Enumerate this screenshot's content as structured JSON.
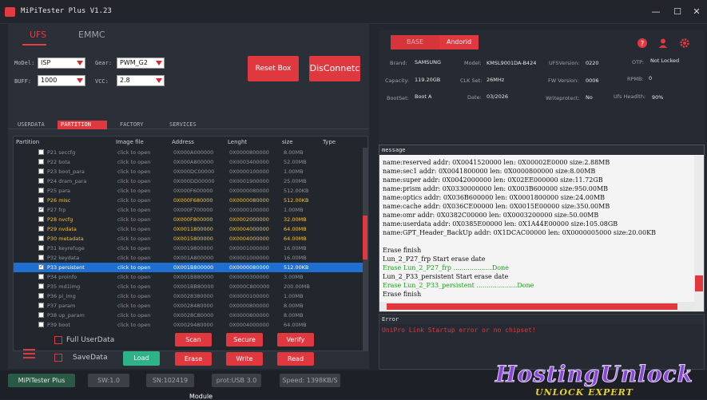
{
  "window": {
    "title": "MiPiTester Plus V1.23"
  },
  "tabs": {
    "ufs": "UFS",
    "emmc": "EMMC"
  },
  "config": {
    "model_label": "MoDel:",
    "model_value": "ISP",
    "gear_label": "Gear:",
    "gear_value": "PWM_G2",
    "buff_label": "BUFF:",
    "buff_value": "1000",
    "vcc_label": "VCC:",
    "vcc_value": "2.8"
  },
  "buttons": {
    "reset_box": "Reset Box",
    "disconnect": "DisConnetc"
  },
  "subtabs": [
    "USERDATA",
    "PARTITION",
    "FACTORY",
    "SERVICES"
  ],
  "table": {
    "headers": [
      "Partition",
      "Image file",
      "Address",
      "Lenght",
      "size",
      "Type"
    ],
    "rows": [
      {
        "name": "P21 seccfg",
        "image": "click to open",
        "addr": "0X000A000000",
        "len": "0X0000800000",
        "size": "8.00MB",
        "checked": false,
        "style": "dim"
      },
      {
        "name": "P22 bota",
        "image": "click to open",
        "addr": "0X000A800000",
        "len": "0X0003400000",
        "size": "52.00MB",
        "checked": false,
        "style": "dim"
      },
      {
        "name": "P23 boot_para",
        "image": "click to open",
        "addr": "0X000DC00000",
        "len": "0X0000100000",
        "size": "1.00MB",
        "checked": false,
        "style": "dim"
      },
      {
        "name": "P24 dram_para",
        "image": "click to open",
        "addr": "0X000DD00000",
        "len": "0X0001900000",
        "size": "25.00MB",
        "checked": false,
        "style": "dim"
      },
      {
        "name": "P25 para",
        "image": "click to open",
        "addr": "0X000F600000",
        "len": "0X0000080000",
        "size": "512.00KB",
        "checked": false,
        "style": "dim"
      },
      {
        "name": "P26 misc",
        "image": "click to open",
        "addr": "0X000F680000",
        "len": "0X0000080000",
        "size": "512.00KB",
        "checked": false,
        "style": "yellow"
      },
      {
        "name": "P27 frp",
        "image": "click to open",
        "addr": "0X000F700000",
        "len": "0X0000100000",
        "size": "1.00MB",
        "checked": true,
        "style": "dim"
      },
      {
        "name": "P28 nvcfg",
        "image": "click to open",
        "addr": "0X000F800000",
        "len": "0X0002000000",
        "size": "32.00MB",
        "checked": false,
        "style": "yellow"
      },
      {
        "name": "P29 nvdata",
        "image": "click to open",
        "addr": "0X0011800000",
        "len": "0X0004000000",
        "size": "64.00MB",
        "checked": false,
        "style": "yellow"
      },
      {
        "name": "P30 metadata",
        "image": "click to open",
        "addr": "0X0015800000",
        "len": "0X0004000000",
        "size": "64.00MB",
        "checked": false,
        "style": "yellow"
      },
      {
        "name": "P31 keyrefuge",
        "image": "click to open",
        "addr": "0X0019800000",
        "len": "0X0001000000",
        "size": "16.00MB",
        "checked": false,
        "style": "dim"
      },
      {
        "name": "P32 keydata",
        "image": "click to open",
        "addr": "0X001A800000",
        "len": "0X0001000000",
        "size": "16.00MB",
        "checked": false,
        "style": "dim"
      },
      {
        "name": "P33 persistent",
        "image": "click to open",
        "addr": "0X001B800000",
        "len": "0X0000080000",
        "size": "512.00KB",
        "checked": true,
        "style": "selected"
      },
      {
        "name": "P34 proinfo",
        "image": "click to open",
        "addr": "0X001B880000",
        "len": "0X0000300000",
        "size": "3.00MB",
        "checked": false,
        "style": "dim"
      },
      {
        "name": "P35 md1img",
        "image": "click to open",
        "addr": "0X001BB80000",
        "len": "0X000C800000",
        "size": "200.00MB",
        "checked": false,
        "style": "dim"
      },
      {
        "name": "P36 pi_img",
        "image": "click to open",
        "addr": "0X0028380000",
        "len": "0X0000100000",
        "size": "1.00MB",
        "checked": false,
        "style": "dim"
      },
      {
        "name": "P37 param",
        "image": "click to open",
        "addr": "0X0028480000",
        "len": "0X0000800000",
        "size": "8.00MB",
        "checked": false,
        "style": "dim"
      },
      {
        "name": "P38 up_param",
        "image": "click to open",
        "addr": "0X0028C80000",
        "len": "0X0000800000",
        "size": "8.00MB",
        "checked": false,
        "style": "dim"
      },
      {
        "name": "P39 boot",
        "image": "click to open",
        "addr": "0X0029480000",
        "len": "0X0004000000",
        "size": "64.00MB",
        "checked": false,
        "style": "dim"
      }
    ]
  },
  "actions": {
    "full_userdata": "Full UserData",
    "savedata": "SaveData",
    "load": "Load",
    "scan": "Scan",
    "secure": "Secure",
    "verify": "Verify",
    "erase": "Erase",
    "write": "Write",
    "read": "Read"
  },
  "status": {
    "app": "MiPiTester Plus",
    "sw": "SW:1.0",
    "sn": "SN:102419",
    "prot": "prot:USB 3.0",
    "speed": "Speed: 1398KB/S",
    "bottom_partial": "Module"
  },
  "device": {
    "tab_base": "BASE",
    "tab_android": "Andorid",
    "brand_label": "Brand:",
    "brand": "SAMSUNG",
    "model_label": "Model:",
    "model": "KMSL9001DA-B424",
    "ufsversion_label": "UFSVersion:",
    "ufsversion": "0220",
    "otp_label": "OTP:",
    "otp": "Not Locked",
    "capacity_label": "Capacity:",
    "capacity": "119.20GB",
    "clkset_label": "CLK Set:",
    "clkset": "26MHz",
    "fwversion_label": "FW Version:",
    "fwversion": "0006",
    "rpmb_label": "RPMB:",
    "rpmb": "0",
    "bootset_label": "BootSet:",
    "bootset": "Boot A",
    "date_label": "Date:",
    "date": "03/2026",
    "writeprotect_label": "Writeprotect:",
    "writeprotect": "No",
    "ufshealth_label": "Ufs Headlth:",
    "ufshealth": "90%"
  },
  "log": {
    "header": "message",
    "lines": [
      {
        "t": "name:reserved addr: 0X0041520000  len: 0X00002E0000  size:2.88MB",
        "c": "#111"
      },
      {
        "t": "name:sec1 addr: 0X0041800000  len: 0X0000800000  size:8.00MB",
        "c": "#111"
      },
      {
        "t": "name:super addr: 0X0042000000  len: 0X02EE000000  size:11.72GB",
        "c": "#111"
      },
      {
        "t": "name:prism addr: 0X0330000000  len: 0X003B600000  size:950.00MB",
        "c": "#111"
      },
      {
        "t": "name:optics addr: 0X036B600000  len: 0X0001800000  size:24.00MB",
        "c": "#111"
      },
      {
        "t": "name:cache addr: 0X036CE00000  len: 0X0015E00000  size:350.00MB",
        "c": "#111"
      },
      {
        "t": "name:omr addr: 0X0382C00000  len: 0X0003200000  size:50.00MB",
        "c": "#111"
      },
      {
        "t": "name:userdata addr: 0X0385E00000  len: 0X1A44E00000  size:105.08GB",
        "c": "#111"
      },
      {
        "t": "name:GPT_Header_BackUp addr: 0X1DCAC00000  len: 0X0000005000  size:20.00KB",
        "c": "#111"
      },
      {
        "t": "",
        "c": "#111"
      },
      {
        "t": "Erase finish",
        "c": "#111"
      },
      {
        "t": "Lun_2_P27_frp Start erase date",
        "c": "#111"
      },
      {
        "t": "Erase  Lun_2_P27_frp  ...................Done",
        "c": "#1aa31a"
      },
      {
        "t": "Lun_2_P33_persistent Start erase date",
        "c": "#111"
      },
      {
        "t": "Erase  Lun_2_P33_persistent  ....................Done",
        "c": "#1aa31a"
      },
      {
        "t": "Erase finish",
        "c": "#111"
      }
    ]
  },
  "error": {
    "header": "Error",
    "text": "UniPro Link Startup error or no chipset!"
  },
  "watermark": {
    "main": "HostingUnlock",
    "sub": "UNLOCK EXPERT"
  },
  "colors": {
    "accent": "#e0383f",
    "selected_row": "#1f6fd0",
    "success": "#1aa31a"
  }
}
